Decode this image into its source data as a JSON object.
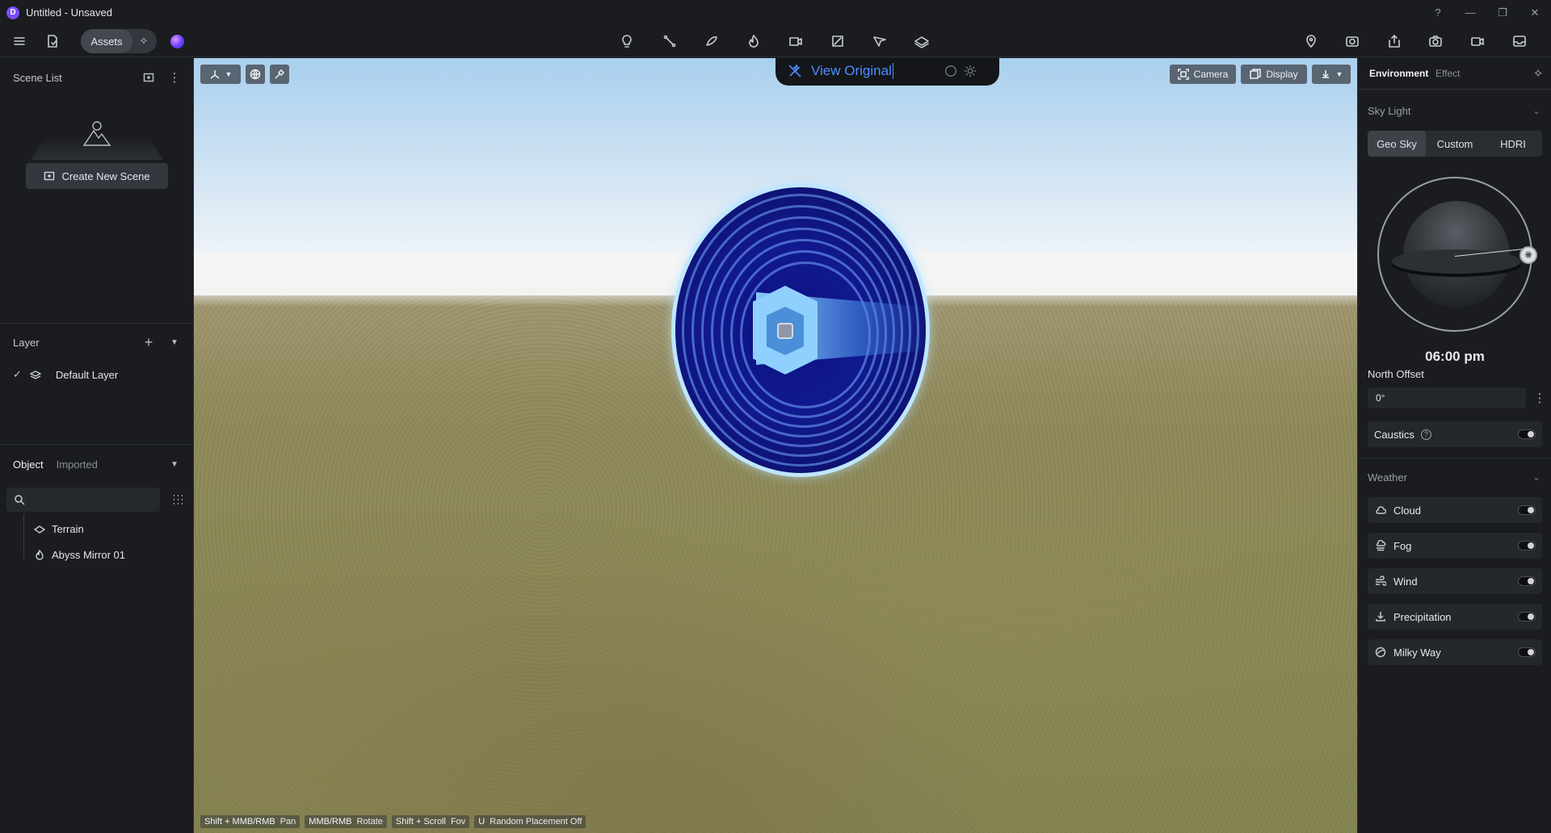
{
  "window": {
    "title": "Untitled - Unsaved",
    "logo_letter": "D",
    "controls": [
      "help-icon",
      "minimize-icon",
      "restore-icon",
      "close-icon"
    ]
  },
  "toolbar": {
    "assets_label": "Assets",
    "center_tools": [
      "light-bulb-icon",
      "path-tool-icon",
      "lasso-tool-icon",
      "flame-icon",
      "video-capture-icon",
      "media-icon",
      "route-icon",
      "terrain-layer-icon"
    ],
    "right_tools": [
      "location-lock-icon",
      "render-icon",
      "export-icon",
      "camera-snapshot-icon",
      "video-record-icon",
      "inbox-icon"
    ]
  },
  "left_panel": {
    "scene_list_title": "Scene List",
    "create_scene_label": "Create New Scene",
    "layer_title": "Layer",
    "default_layer": "Default Layer",
    "tabs": [
      "Object",
      "Imported"
    ],
    "objects": [
      "Terrain",
      "Abyss Mirror 01"
    ]
  },
  "viewport": {
    "view_original": "View Original",
    "camera_label": "Camera",
    "display_label": "Display",
    "hints": [
      {
        "key": "Shift + MMB/RMB",
        "action": "Pan"
      },
      {
        "key": "MMB/RMB",
        "action": "Rotate"
      },
      {
        "key": "Shift + Scroll",
        "action": "Fov"
      },
      {
        "key": "U",
        "action": "Random Placement Off"
      }
    ]
  },
  "right_panel": {
    "tabs": [
      "Environment",
      "Effect"
    ],
    "sky_light_title": "Sky Light",
    "sky_modes": [
      "Geo Sky",
      "Custom",
      "HDRI"
    ],
    "sky_mode_selected": "Geo Sky",
    "time": "06:00 pm",
    "north_offset_label": "North Offset",
    "north_offset_value": "0°",
    "caustics_label": "Caustics",
    "weather_title": "Weather",
    "weather_items": [
      {
        "label": "Cloud",
        "icon": "cloud-icon",
        "on": false
      },
      {
        "label": "Fog",
        "icon": "fog-icon",
        "on": false
      },
      {
        "label": "Wind",
        "icon": "wind-icon",
        "on": false
      },
      {
        "label": "Precipitation",
        "icon": "precipitation-icon",
        "on": false
      },
      {
        "label": "Milky Way",
        "icon": "milky-way-icon",
        "on": false
      }
    ]
  },
  "colors": {
    "accent_blue": "#4d8dff",
    "brand_purple": "#7b4dff",
    "panel_bg": "#1a1c20"
  }
}
